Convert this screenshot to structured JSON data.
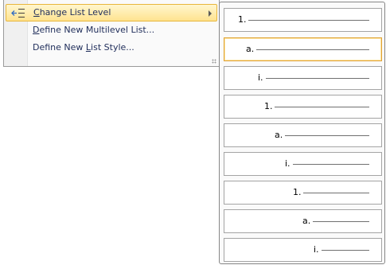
{
  "menu": {
    "items": [
      {
        "label": "Change List Level",
        "mnemonic": "C",
        "icon": "change-list-level-icon",
        "submenu": true,
        "active": true
      },
      {
        "label": "Define New Multilevel List...",
        "mnemonic": "D",
        "submenu": false
      },
      {
        "label": "Define New List Style...",
        "mnemonic": "L",
        "submenu": false
      }
    ]
  },
  "list_levels": {
    "levels": [
      {
        "marker": "1."
      },
      {
        "marker": "a.",
        "selected": true
      },
      {
        "marker": "i."
      },
      {
        "marker": "1."
      },
      {
        "marker": "a."
      },
      {
        "marker": "i."
      },
      {
        "marker": "1."
      },
      {
        "marker": "a."
      },
      {
        "marker": "i."
      }
    ]
  },
  "colors": {
    "highlight_top": "#fff6cf",
    "highlight_bottom": "#ffe38f",
    "highlight_border": "#e8b63b",
    "text": "#1f2d5a"
  }
}
